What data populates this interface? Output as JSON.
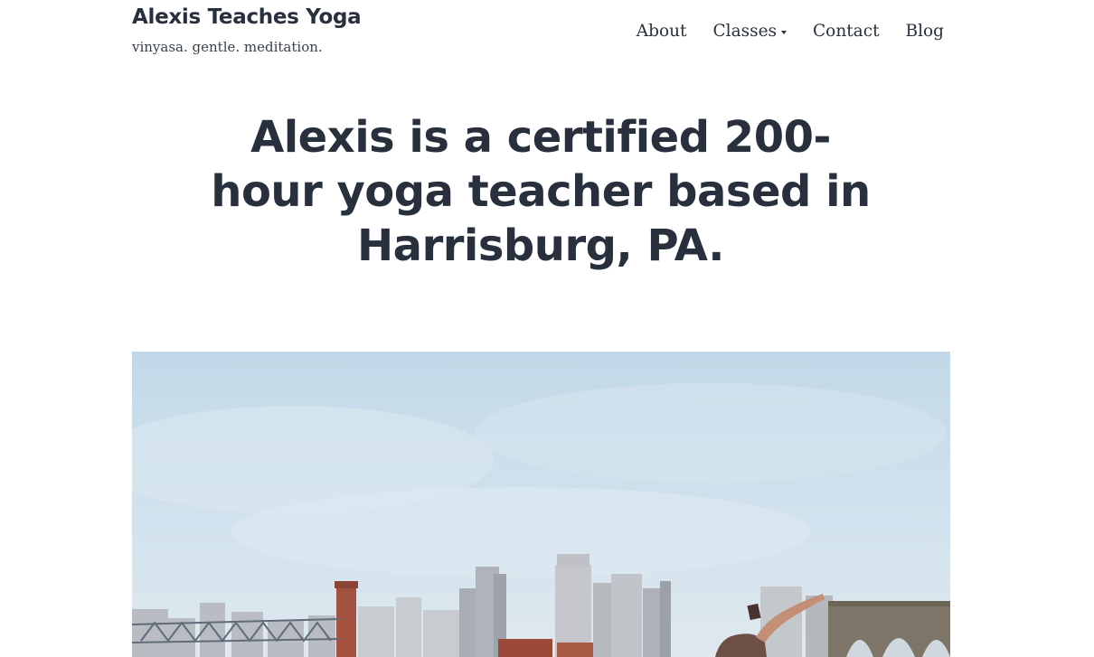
{
  "site": {
    "title": "Alexis Teaches Yoga",
    "tagline": "vinyasa. gentle. meditation."
  },
  "nav": {
    "items": [
      {
        "label": "About"
      },
      {
        "label": "Classes",
        "has_submenu": true
      },
      {
        "label": "Contact"
      },
      {
        "label": "Blog"
      }
    ]
  },
  "hero": {
    "heading": "Alexis is a certified 200-hour yoga teacher based in Harrisburg, PA."
  },
  "colors": {
    "text": "#28303d",
    "background": "#ffffff",
    "sky": "#c7dcea"
  }
}
